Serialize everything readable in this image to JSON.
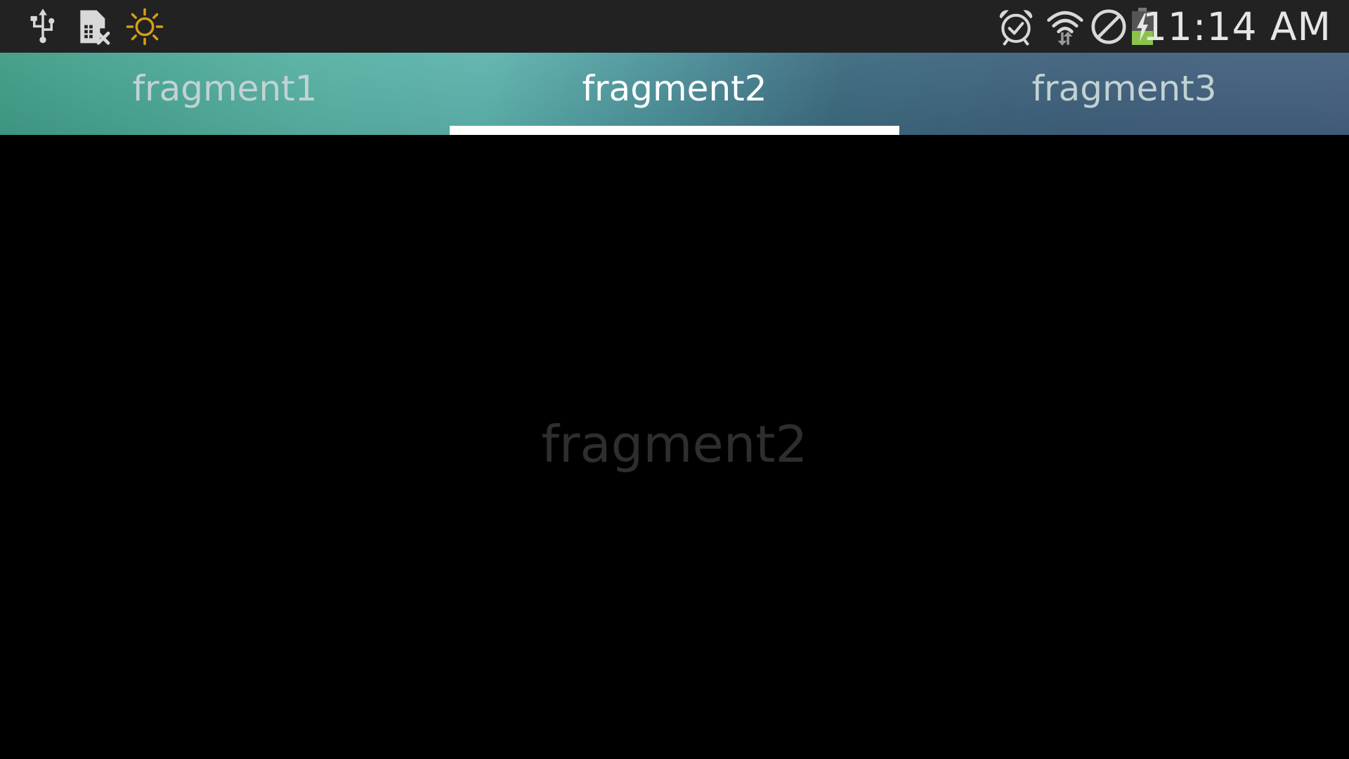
{
  "status_bar": {
    "time": "11:14 AM",
    "left_icons": [
      "usb-icon",
      "sim-card-error-icon",
      "brightness-icon"
    ],
    "right_icons": [
      "alarm-icon",
      "wifi-icon",
      "do-not-disturb-icon",
      "battery-charging-icon"
    ],
    "colors": {
      "background": "#222222",
      "brightness_icon": "#d4a017",
      "battery_fill": "#8bc34a"
    }
  },
  "tabs": {
    "items": [
      {
        "label": "fragment1",
        "selected": false
      },
      {
        "label": "fragment2",
        "selected": true
      },
      {
        "label": "fragment3",
        "selected": false
      }
    ],
    "colors": {
      "active_text": "#ffffff",
      "inactive_text": "#c2d2d2",
      "indicator": "#ffffff"
    }
  },
  "content": {
    "label": "fragment2",
    "colors": {
      "background": "#000000",
      "text": "#2e2e2e"
    }
  }
}
